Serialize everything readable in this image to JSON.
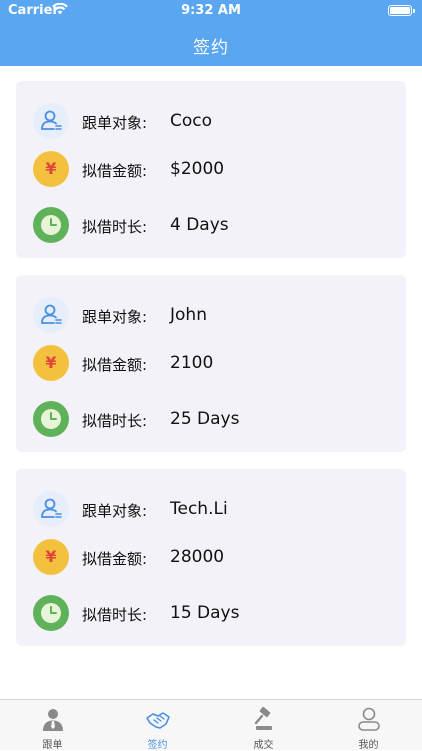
{
  "status_bar": {
    "carrier": "Carrier",
    "time": "9:32 AM"
  },
  "header": {
    "title": "签约"
  },
  "labels": {
    "target": "跟单对象:",
    "amount": "拟借金额:",
    "duration": "拟借时长:"
  },
  "icons": {
    "money_glyph": "¥"
  },
  "records": [
    {
      "target": "Coco",
      "amount": "$2000",
      "duration": "4 Days"
    },
    {
      "target": "John",
      "amount": "2100",
      "duration": "25 Days"
    },
    {
      "target": "Tech.Li",
      "amount": "28000",
      "duration": "15 Days"
    }
  ],
  "tabs": [
    {
      "label": "跟单",
      "icon": "user-tie-icon"
    },
    {
      "label": "签约",
      "icon": "handshake-icon",
      "active": true
    },
    {
      "label": "成交",
      "icon": "gavel-icon"
    },
    {
      "label": "我的",
      "icon": "profile-icon"
    }
  ],
  "colors": {
    "header": "#5aa6f1",
    "active_tab": "#4a90e2",
    "card_bg": "#f2f2f8"
  }
}
